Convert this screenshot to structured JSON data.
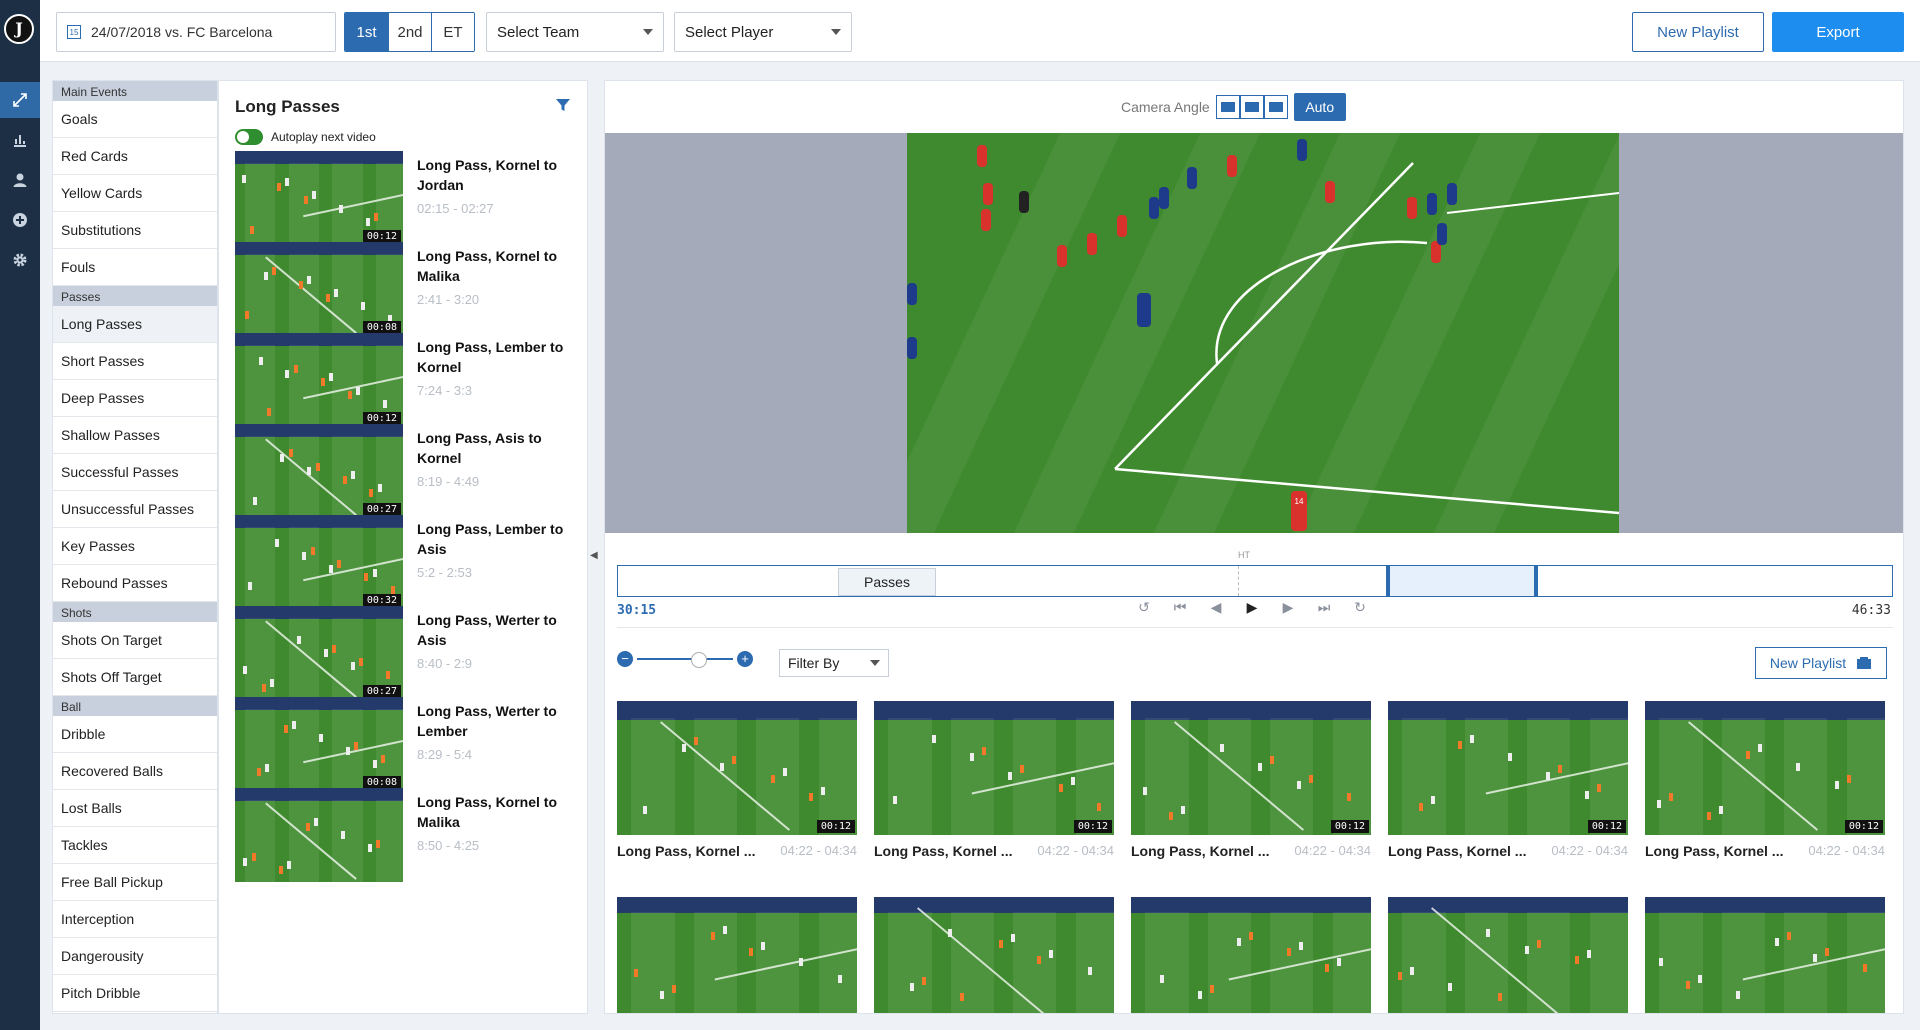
{
  "header": {
    "date_match": "24/07/2018 vs. FC Barcelona",
    "calendar_day": "15",
    "halves": [
      "1st",
      "2nd",
      "ET"
    ],
    "select_team": "Select Team",
    "select_player": "Select Player",
    "new_playlist": "New Playlist",
    "export": "Export"
  },
  "categories": {
    "main_events": "Main Events",
    "main_items": [
      "Goals",
      "Red Cards",
      "Yellow Cards",
      "Substitutions",
      "Fouls"
    ],
    "passes": "Passes",
    "pass_items": [
      "Long Passes",
      "Short Passes",
      "Deep Passes",
      "Shallow Passes",
      "Successful Passes",
      "Unsuccessful Passes",
      "Key Passes",
      "Rebound Passes"
    ],
    "shots": "Shots",
    "shot_items": [
      "Shots On Target",
      "Shots Off Target"
    ],
    "ball": "Ball",
    "ball_items": [
      "Dribble",
      "Recovered Balls",
      "Lost Balls",
      "Tackles",
      "Free Ball Pickup",
      "Interception",
      "Dangerousity",
      "Pitch Dribble"
    ]
  },
  "events": {
    "title": "Long Passes",
    "autoplay": "Autoplay next video",
    "items": [
      {
        "title": "Long Pass, Kornel to Jordan",
        "time": "02:15 - 02:27",
        "dur": "00:12"
      },
      {
        "title": "Long Pass, Kornel to Malika",
        "time": "2:41 - 3:20",
        "dur": "00:08"
      },
      {
        "title": "Long Pass, Lember to Kornel",
        "time": "7:24 - 3:3",
        "dur": "00:12"
      },
      {
        "title": "Long Pass, Asis to Kornel",
        "time": "8:19 - 4:49",
        "dur": "00:27"
      },
      {
        "title": "Long Pass, Lember to Asis",
        "time": "5:2 - 2:53",
        "dur": "00:32"
      },
      {
        "title": "Long Pass, Werter to Asis",
        "time": "8:40 - 2:9",
        "dur": "00:27"
      },
      {
        "title": "Long Pass, Werter to Lember",
        "time": "8:29 - 5:4",
        "dur": "00:08"
      },
      {
        "title": "Long Pass, Kornel to Malika",
        "time": "8:50 - 4:25",
        "dur": ""
      }
    ]
  },
  "player": {
    "camera_angle": "Camera Angle",
    "auto": "Auto",
    "ht": "HT",
    "timeline_label": "Passes",
    "current_time": "30:15",
    "end_time": "46:33",
    "jersey": "14"
  },
  "clips": {
    "filter_by": "Filter By",
    "new_playlist": "New Playlist",
    "row1": [
      {
        "title": "Long Pass, Kornel ...",
        "time": "04:22 - 04:34",
        "dur": "00:12"
      },
      {
        "title": "Long Pass, Kornel ...",
        "time": "04:22 - 04:34",
        "dur": "00:12"
      },
      {
        "title": "Long Pass, Kornel ...",
        "time": "04:22 - 04:34",
        "dur": "00:12"
      },
      {
        "title": "Long Pass, Kornel ...",
        "time": "04:22 - 04:34",
        "dur": "00:12"
      },
      {
        "title": "Long Pass, Kornel ...",
        "time": "04:22 - 04:34",
        "dur": "00:12"
      }
    ]
  },
  "colors": {
    "accent": "#2c6bb0",
    "export": "#1e8df0",
    "rail": "#1c2f44",
    "pitch": "#3f8a2e"
  }
}
